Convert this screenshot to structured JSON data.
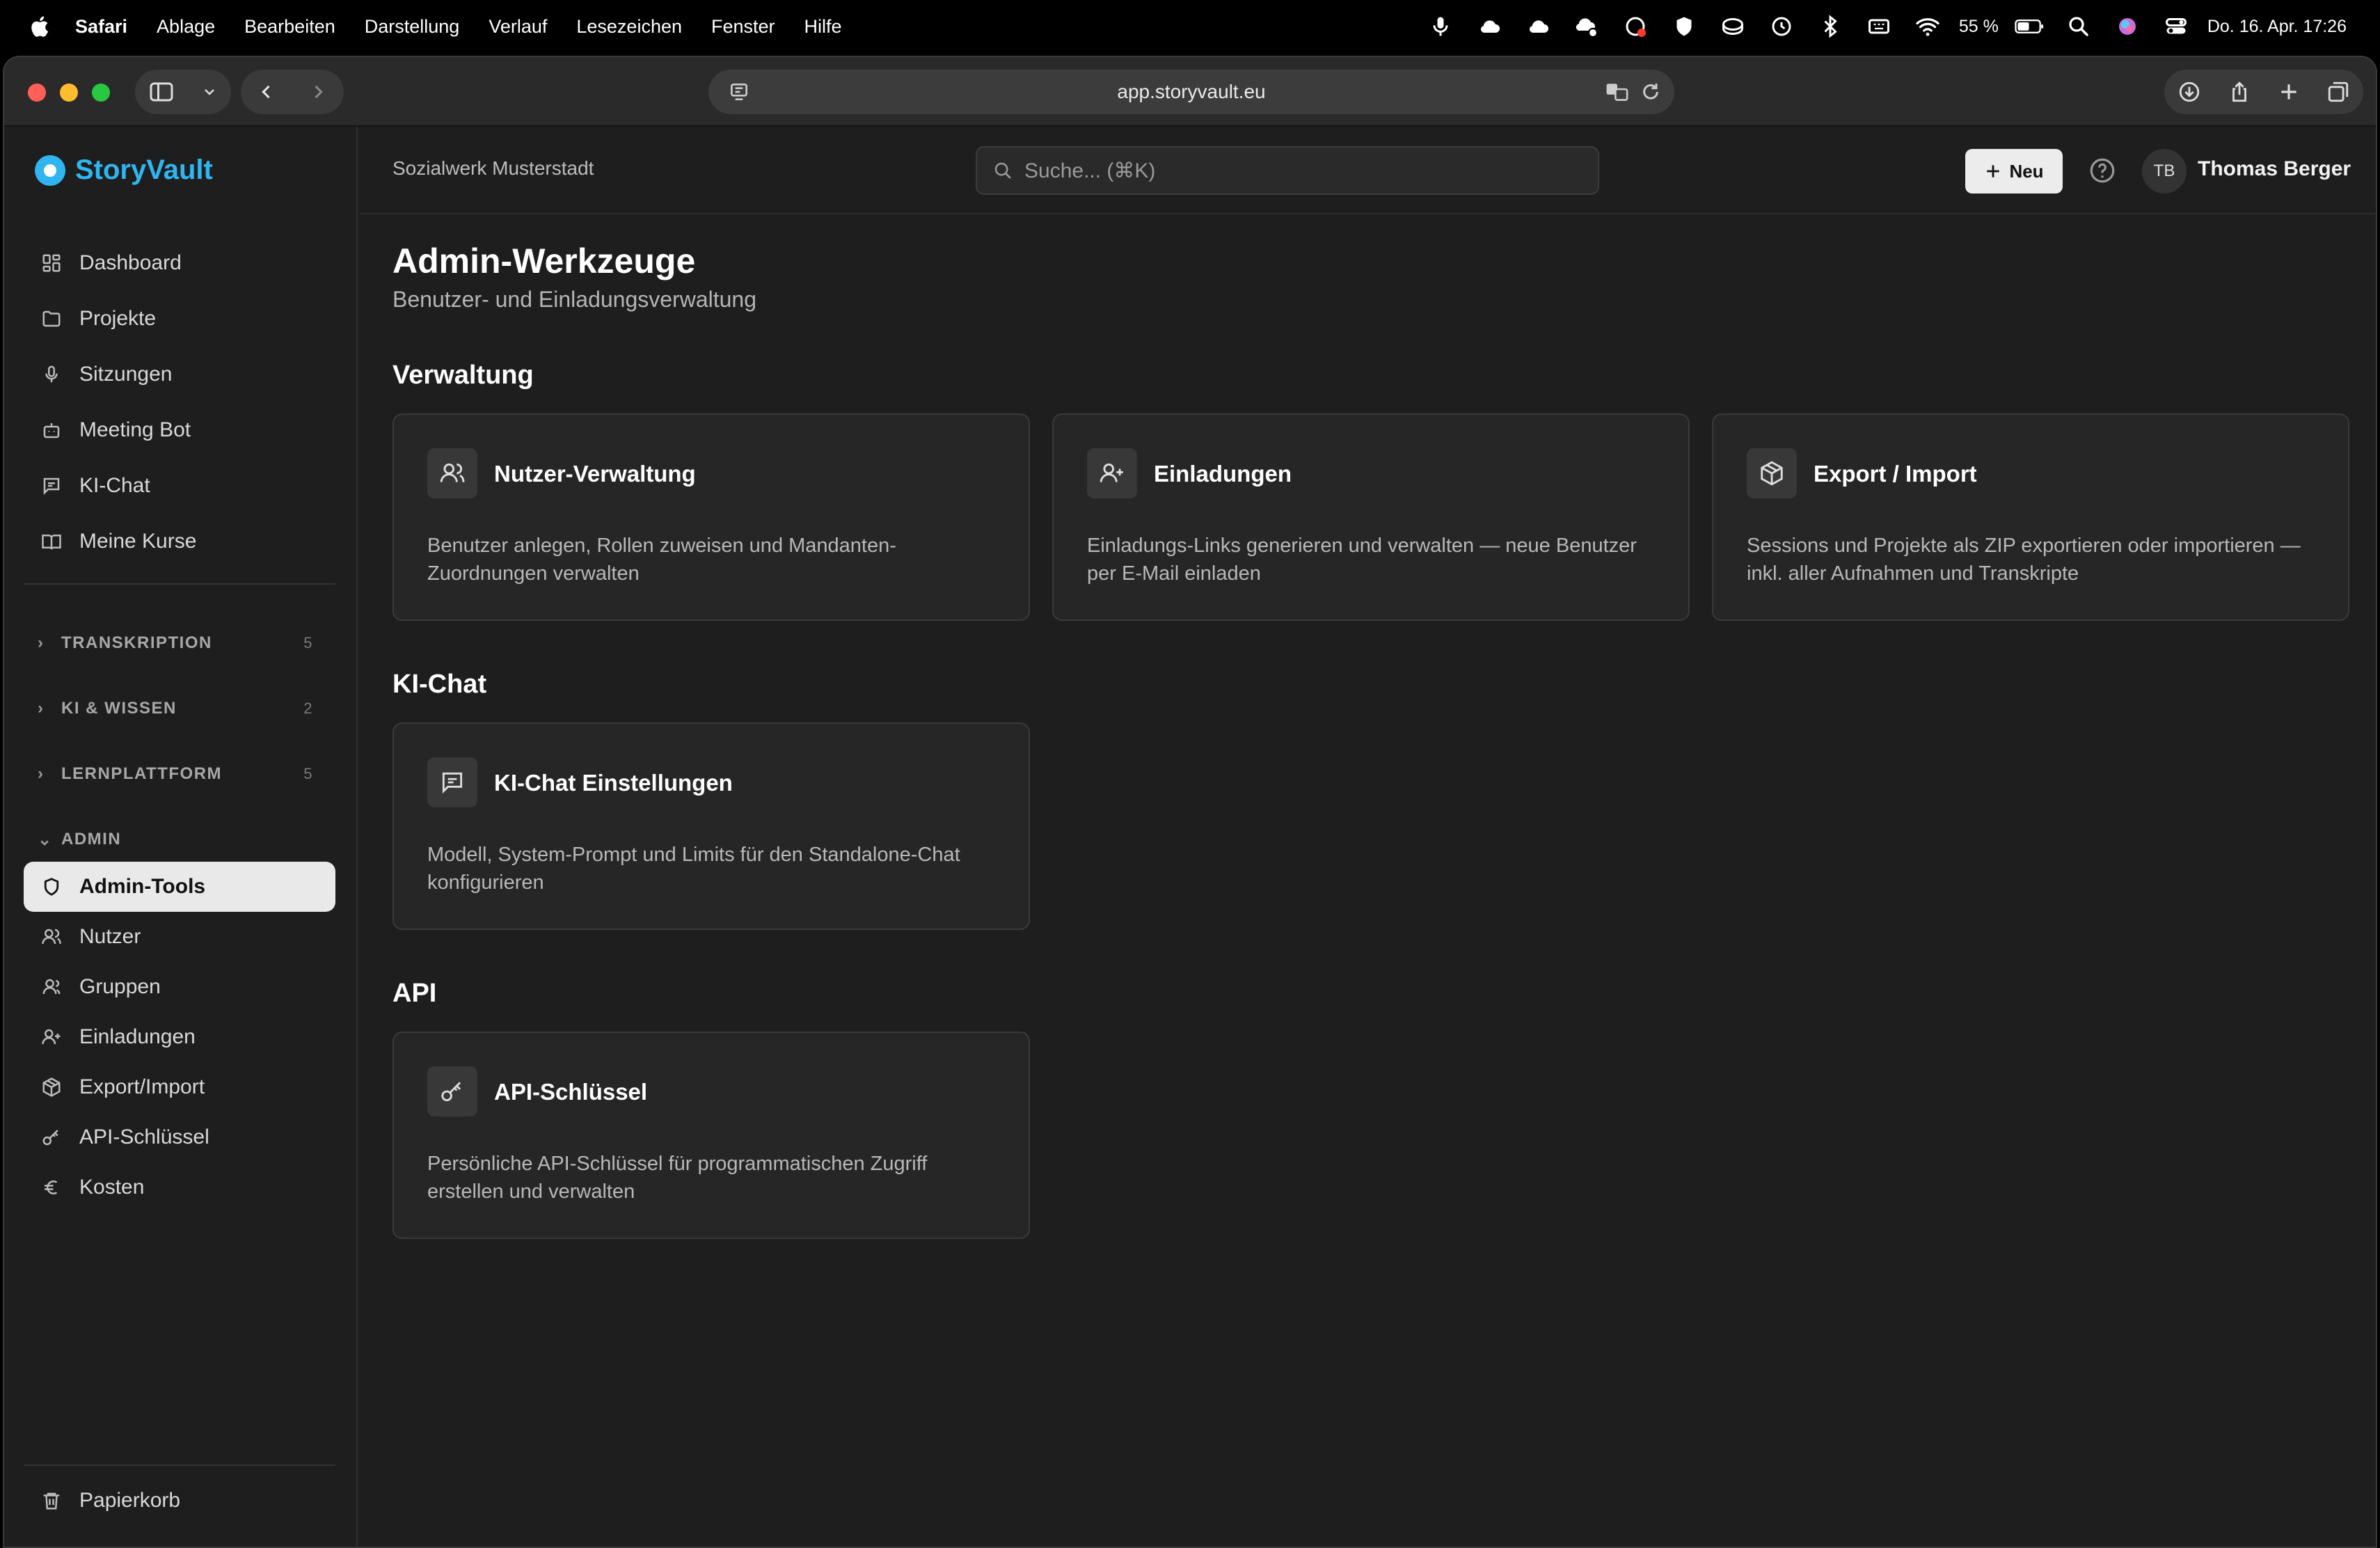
{
  "menubar": {
    "app": "Safari",
    "items": [
      "Ablage",
      "Bearbeiten",
      "Darstellung",
      "Verlauf",
      "Lesezeichen",
      "Fenster",
      "Hilfe"
    ],
    "battery": "55 %",
    "datetime": "Do. 16. Apr.  17:26"
  },
  "browser": {
    "url": "app.storyvault.eu"
  },
  "app": {
    "brand": "StoryVault",
    "brand_color": "#2fb6f0",
    "org": "Sozialwerk Musterstadt",
    "search_placeholder": "Suche... (⌘K)",
    "new_label": "Neu",
    "user_initials": "TB",
    "user_name": "Thomas Berger"
  },
  "sidebar": {
    "main_items": [
      {
        "label": "Dashboard",
        "icon": "dashboard-icon"
      },
      {
        "label": "Projekte",
        "icon": "folder-icon"
      },
      {
        "label": "Sitzungen",
        "icon": "microphone-icon"
      },
      {
        "label": "Meeting Bot",
        "icon": "bot-icon"
      },
      {
        "label": "KI-Chat",
        "icon": "chat-icon"
      },
      {
        "label": "Meine Kurse",
        "icon": "book-icon"
      }
    ],
    "sections": [
      {
        "label": "TRANSKRIPTION",
        "count": "5"
      },
      {
        "label": "KI & WISSEN",
        "count": "2"
      },
      {
        "label": "LERNPLATTFORM",
        "count": "5"
      }
    ],
    "admin_section": "ADMIN",
    "admin_items": [
      {
        "label": "Admin-Tools",
        "icon": "shield-icon",
        "active": true
      },
      {
        "label": "Nutzer",
        "icon": "users-icon"
      },
      {
        "label": "Gruppen",
        "icon": "group-icon"
      },
      {
        "label": "Einladungen",
        "icon": "user-plus-icon"
      },
      {
        "label": "Export/Import",
        "icon": "package-icon"
      },
      {
        "label": "API-Schlüssel",
        "icon": "key-icon"
      },
      {
        "label": "Kosten",
        "icon": "euro-icon"
      }
    ],
    "trash": "Papierkorb"
  },
  "page": {
    "title": "Admin-Werkzeuge",
    "subtitle": "Benutzer- und Einladungsverwaltung",
    "groups": [
      {
        "title": "Verwaltung",
        "cards": [
          {
            "title": "Nutzer-Verwaltung",
            "desc": "Benutzer anlegen, Rollen zuweisen und Mandanten-Zuordnungen verwalten",
            "icon": "users-icon"
          },
          {
            "title": "Einladungen",
            "desc": "Einladungs-Links generieren und verwalten — neue Benutzer per E-Mail einladen",
            "icon": "user-plus-icon"
          },
          {
            "title": "Export / Import",
            "desc": "Sessions und Projekte als ZIP exportieren oder importieren — inkl. aller Aufnahmen und Transkripte",
            "icon": "package-icon"
          }
        ]
      },
      {
        "title": "KI-Chat",
        "cards": [
          {
            "title": "KI-Chat Einstellungen",
            "desc": "Modell, System-Prompt und Limits für den Standalone-Chat konfigurieren",
            "icon": "chat-icon"
          }
        ]
      },
      {
        "title": "API",
        "cards": [
          {
            "title": "API-Schlüssel",
            "desc": "Persönliche API-Schlüssel für programmatischen Zugriff erstellen und verwalten",
            "icon": "key-icon"
          }
        ]
      }
    ]
  }
}
